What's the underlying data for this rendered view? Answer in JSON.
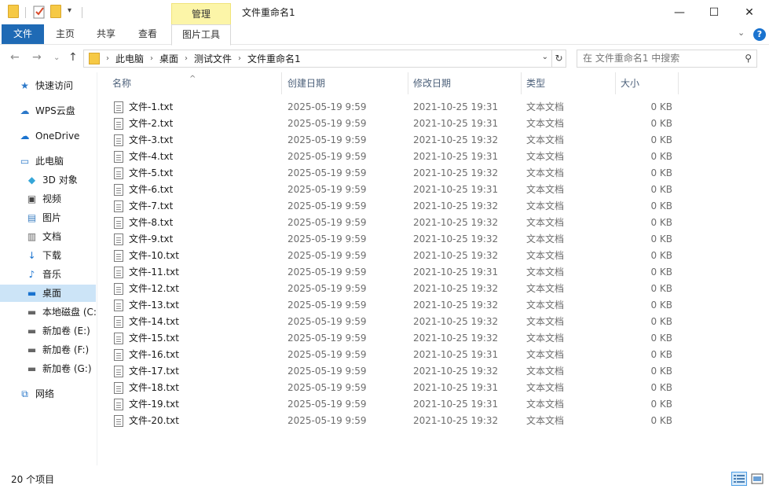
{
  "window": {
    "title": "文件重命名1",
    "context_tab_group": "管理",
    "minimize_glyph": "—",
    "maximize_glyph": "☐",
    "close_glyph": "✕"
  },
  "ribbon": {
    "tabs": [
      "文件",
      "主页",
      "共享",
      "查看",
      "图片工具"
    ],
    "collapse_glyph": "⌄",
    "help_glyph": "?"
  },
  "address": {
    "crumbs": [
      "此电脑",
      "桌面",
      "测试文件",
      "文件重命名1"
    ],
    "search_placeholder": "在 文件重命名1 中搜索"
  },
  "sidebar": {
    "items": [
      {
        "label": "快速访问",
        "icon": "star-icon"
      },
      {
        "label": "WPS云盘",
        "icon": "cloud-icon"
      },
      {
        "label": "OneDrive",
        "icon": "onedrive-icon"
      },
      {
        "label": "此电脑",
        "icon": "computer-icon"
      },
      {
        "label": "3D 对象",
        "icon": "cube-icon"
      },
      {
        "label": "视频",
        "icon": "video-icon"
      },
      {
        "label": "图片",
        "icon": "picture-icon"
      },
      {
        "label": "文档",
        "icon": "document-icon"
      },
      {
        "label": "下载",
        "icon": "download-icon"
      },
      {
        "label": "音乐",
        "icon": "music-icon"
      },
      {
        "label": "桌面",
        "icon": "desktop-icon"
      },
      {
        "label": "本地磁盘 (C:",
        "icon": "drive-icon"
      },
      {
        "label": "新加卷 (E:)",
        "icon": "drive-icon"
      },
      {
        "label": "新加卷 (F:)",
        "icon": "drive-icon"
      },
      {
        "label": "新加卷 (G:)",
        "icon": "drive-icon"
      },
      {
        "label": "网络",
        "icon": "network-icon"
      }
    ]
  },
  "columns": [
    "名称",
    "创建日期",
    "修改日期",
    "类型",
    "大小"
  ],
  "files": [
    {
      "name": "文件-1.txt",
      "created": "2025-05-19 9:59",
      "modified": "2021-10-25 19:31",
      "type": "文本文档",
      "size": "0 KB"
    },
    {
      "name": "文件-2.txt",
      "created": "2025-05-19 9:59",
      "modified": "2021-10-25 19:31",
      "type": "文本文档",
      "size": "0 KB"
    },
    {
      "name": "文件-3.txt",
      "created": "2025-05-19 9:59",
      "modified": "2021-10-25 19:32",
      "type": "文本文档",
      "size": "0 KB"
    },
    {
      "name": "文件-4.txt",
      "created": "2025-05-19 9:59",
      "modified": "2021-10-25 19:31",
      "type": "文本文档",
      "size": "0 KB"
    },
    {
      "name": "文件-5.txt",
      "created": "2025-05-19 9:59",
      "modified": "2021-10-25 19:32",
      "type": "文本文档",
      "size": "0 KB"
    },
    {
      "name": "文件-6.txt",
      "created": "2025-05-19 9:59",
      "modified": "2021-10-25 19:31",
      "type": "文本文档",
      "size": "0 KB"
    },
    {
      "name": "文件-7.txt",
      "created": "2025-05-19 9:59",
      "modified": "2021-10-25 19:32",
      "type": "文本文档",
      "size": "0 KB"
    },
    {
      "name": "文件-8.txt",
      "created": "2025-05-19 9:59",
      "modified": "2021-10-25 19:32",
      "type": "文本文档",
      "size": "0 KB"
    },
    {
      "name": "文件-9.txt",
      "created": "2025-05-19 9:59",
      "modified": "2021-10-25 19:32",
      "type": "文本文档",
      "size": "0 KB"
    },
    {
      "name": "文件-10.txt",
      "created": "2025-05-19 9:59",
      "modified": "2021-10-25 19:32",
      "type": "文本文档",
      "size": "0 KB"
    },
    {
      "name": "文件-11.txt",
      "created": "2025-05-19 9:59",
      "modified": "2021-10-25 19:31",
      "type": "文本文档",
      "size": "0 KB"
    },
    {
      "name": "文件-12.txt",
      "created": "2025-05-19 9:59",
      "modified": "2021-10-25 19:32",
      "type": "文本文档",
      "size": "0 KB"
    },
    {
      "name": "文件-13.txt",
      "created": "2025-05-19 9:59",
      "modified": "2021-10-25 19:32",
      "type": "文本文档",
      "size": "0 KB"
    },
    {
      "name": "文件-14.txt",
      "created": "2025-05-19 9:59",
      "modified": "2021-10-25 19:32",
      "type": "文本文档",
      "size": "0 KB"
    },
    {
      "name": "文件-15.txt",
      "created": "2025-05-19 9:59",
      "modified": "2021-10-25 19:32",
      "type": "文本文档",
      "size": "0 KB"
    },
    {
      "name": "文件-16.txt",
      "created": "2025-05-19 9:59",
      "modified": "2021-10-25 19:31",
      "type": "文本文档",
      "size": "0 KB"
    },
    {
      "name": "文件-17.txt",
      "created": "2025-05-19 9:59",
      "modified": "2021-10-25 19:32",
      "type": "文本文档",
      "size": "0 KB"
    },
    {
      "name": "文件-18.txt",
      "created": "2025-05-19 9:59",
      "modified": "2021-10-25 19:31",
      "type": "文本文档",
      "size": "0 KB"
    },
    {
      "name": "文件-19.txt",
      "created": "2025-05-19 9:59",
      "modified": "2021-10-25 19:31",
      "type": "文本文档",
      "size": "0 KB"
    },
    {
      "name": "文件-20.txt",
      "created": "2025-05-19 9:59",
      "modified": "2021-10-25 19:32",
      "type": "文本文档",
      "size": "0 KB"
    }
  ],
  "status": {
    "item_count": "20 个项目"
  },
  "colors": {
    "file_tab": "#1f6ab5",
    "context_tab": "#fcf5a8",
    "selected_nav": "#cce4f7",
    "header_text": "#4c607a"
  }
}
